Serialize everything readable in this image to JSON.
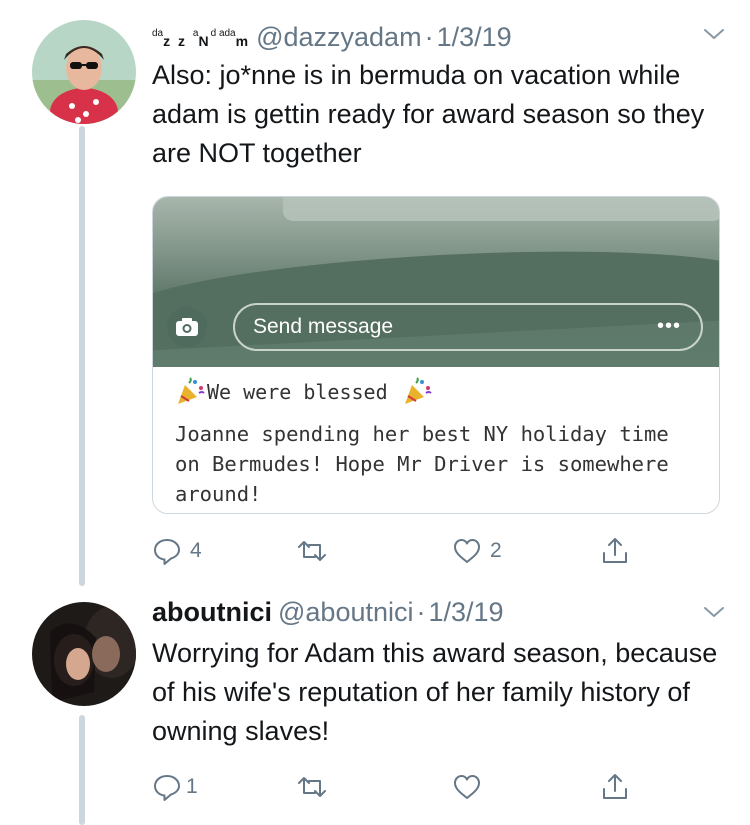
{
  "tweets": [
    {
      "display_name_parts": [
        "da",
        "z z ",
        "a",
        "N",
        "d ",
        "ada",
        "m"
      ],
      "handle": "@dazzyadam",
      "separator": "·",
      "date": "1/3/19",
      "text": "Also: jo*nne is in bermuda on vacation while adam is gettin ready for award season so they are NOT together",
      "media": {
        "message_placeholder": "Send message",
        "more_label": "•••",
        "heading": "We were blessed",
        "body": "Joanne spending her best NY holiday time on Bermudes! Hope Mr Driver is somewhere around!"
      },
      "actions": {
        "replies": "4",
        "retweets": "",
        "likes": "2"
      }
    },
    {
      "display_name": "aboutnici",
      "handle": "@aboutnici",
      "separator": "·",
      "date": "1/3/19",
      "text": "Worrying for Adam this award season, because of his wife's reputation of her family history of owning slaves!",
      "actions": {
        "replies": "1",
        "retweets": "",
        "likes": ""
      }
    }
  ],
  "colors": {
    "text": "#14171a",
    "muted": "#657786",
    "thread_line": "#ccd6dd"
  },
  "icons": [
    "reply-icon",
    "retweet-icon",
    "like-icon",
    "share-icon",
    "chevron-down-icon",
    "camera-icon",
    "party-popper-icon"
  ]
}
